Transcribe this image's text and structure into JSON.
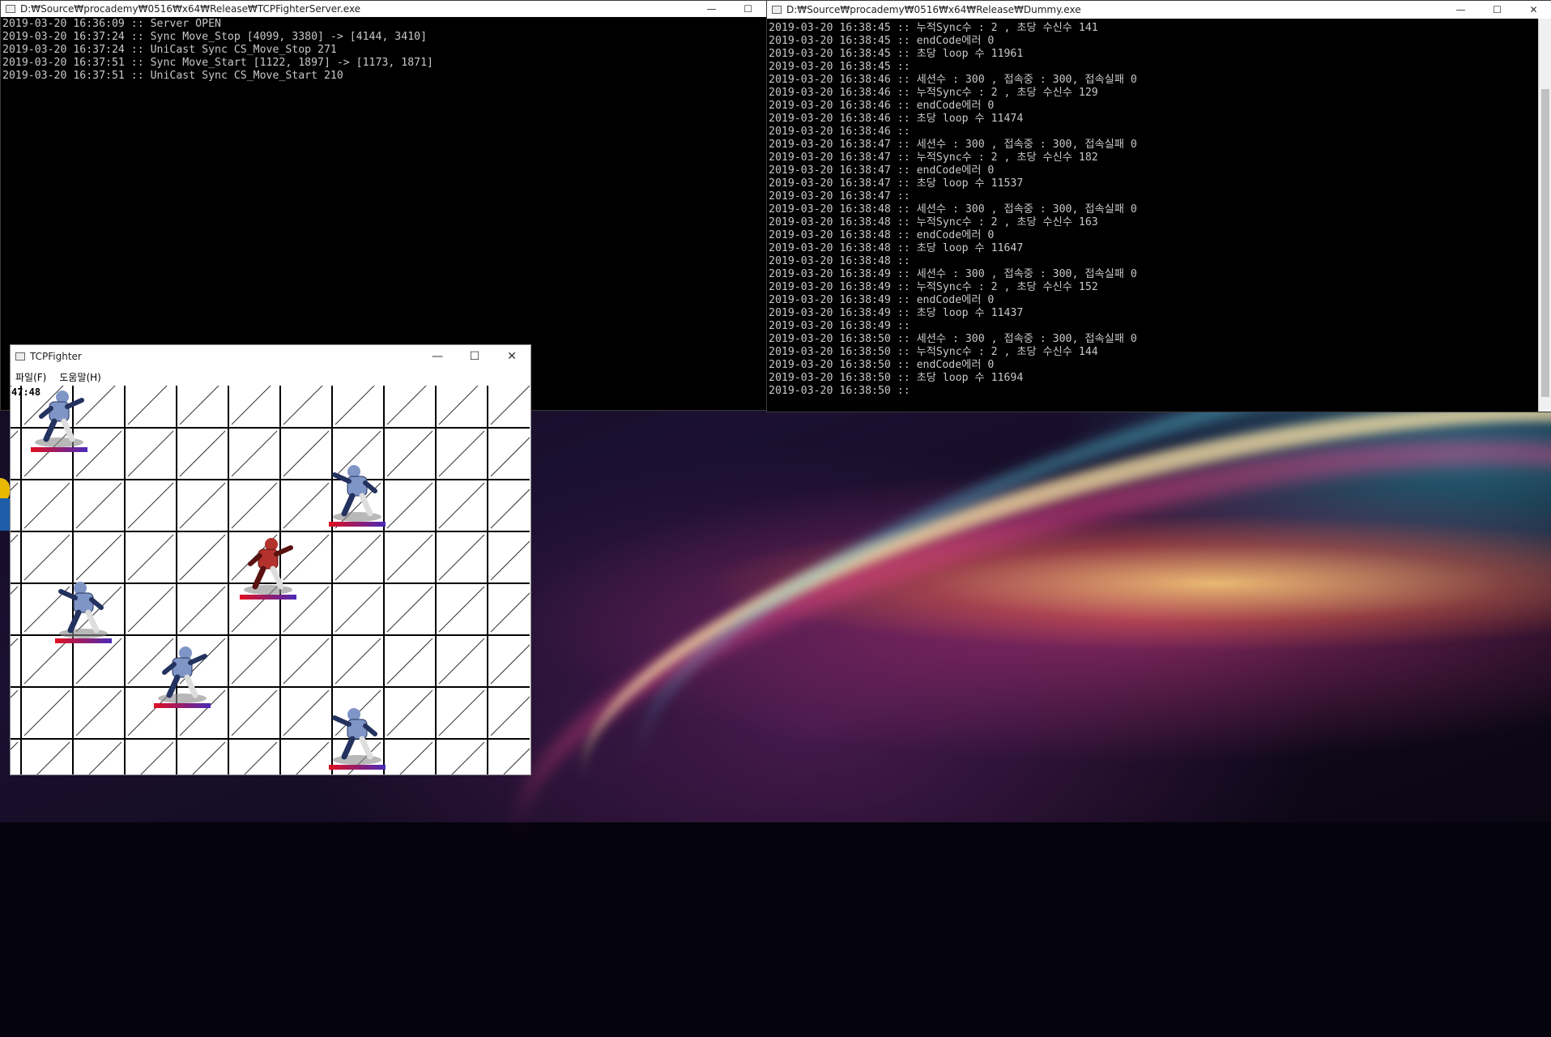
{
  "server_window": {
    "title": "D:₩Source₩procademy₩0516₩x64₩Release₩TCPFighterServer.exe",
    "lines": [
      "2019-03-20 16:36:09 :: Server OPEN",
      "2019-03-20 16:37:24 :: Sync Move_Stop [4099, 3380] -> [4144, 3410]",
      "2019-03-20 16:37:24 :: UniCast Sync CS_Move_Stop 271",
      "2019-03-20 16:37:51 :: Sync Move_Start [1122, 1897] -> [1173, 1871]",
      "2019-03-20 16:37:51 :: UniCast Sync CS_Move_Start 210"
    ]
  },
  "dummy_window": {
    "title": "D:₩Source₩procademy₩0516₩x64₩Release₩Dummy.exe",
    "lines": [
      "2019-03-20 16:38:45 :: 누적Sync수 : 2 , 초당 수신수 141",
      "2019-03-20 16:38:45 :: endCode에러 0",
      "2019-03-20 16:38:45 :: 초당 loop 수 11961",
      "2019-03-20 16:38:45 ::",
      "2019-03-20 16:38:46 :: 세션수 : 300 , 접속중 : 300, 접속실패 0",
      "2019-03-20 16:38:46 :: 누적Sync수 : 2 , 초당 수신수 129",
      "2019-03-20 16:38:46 :: endCode에러 0",
      "2019-03-20 16:38:46 :: 초당 loop 수 11474",
      "2019-03-20 16:38:46 ::",
      "2019-03-20 16:38:47 :: 세션수 : 300 , 접속중 : 300, 접속실패 0",
      "2019-03-20 16:38:47 :: 누적Sync수 : 2 , 초당 수신수 182",
      "2019-03-20 16:38:47 :: endCode에러 0",
      "2019-03-20 16:38:47 :: 초당 loop 수 11537",
      "2019-03-20 16:38:47 ::",
      "2019-03-20 16:38:48 :: 세션수 : 300 , 접속중 : 300, 접속실패 0",
      "2019-03-20 16:38:48 :: 누적Sync수 : 2 , 초당 수신수 163",
      "2019-03-20 16:38:48 :: endCode에러 0",
      "2019-03-20 16:38:48 :: 초당 loop 수 11647",
      "2019-03-20 16:38:48 ::",
      "2019-03-20 16:38:49 :: 세션수 : 300 , 접속중 : 300, 접속실패 0",
      "2019-03-20 16:38:49 :: 누적Sync수 : 2 , 초당 수신수 152",
      "2019-03-20 16:38:49 :: endCode에러 0",
      "2019-03-20 16:38:49 :: 초당 loop 수 11437",
      "2019-03-20 16:38:49 ::",
      "2019-03-20 16:38:50 :: 세션수 : 300 , 접속중 : 300, 접속실패 0",
      "2019-03-20 16:38:50 :: 누적Sync수 : 2 , 초당 수신수 144",
      "2019-03-20 16:38:50 :: endCode에러 0",
      "2019-03-20 16:38:50 :: 초당 loop 수 11694",
      "2019-03-20 16:38:50 ::"
    ]
  },
  "game_window": {
    "title": "TCPFighter",
    "menu": [
      "파일(F)",
      "도움말(H)"
    ],
    "timer": "47:48",
    "fighters": [
      {
        "color": "blue",
        "facing": "right",
        "hp": 1.0
      },
      {
        "color": "blue",
        "facing": "left",
        "hp": 1.0
      },
      {
        "color": "red",
        "facing": "right",
        "hp": 1.0
      },
      {
        "color": "blue",
        "facing": "left",
        "hp": 1.0
      },
      {
        "color": "blue",
        "facing": "right",
        "hp": 1.0
      },
      {
        "color": "blue",
        "facing": "left",
        "hp": 1.0
      }
    ]
  },
  "window_controls": {
    "minimize": "—",
    "maximize": "☐",
    "close": "✕"
  }
}
